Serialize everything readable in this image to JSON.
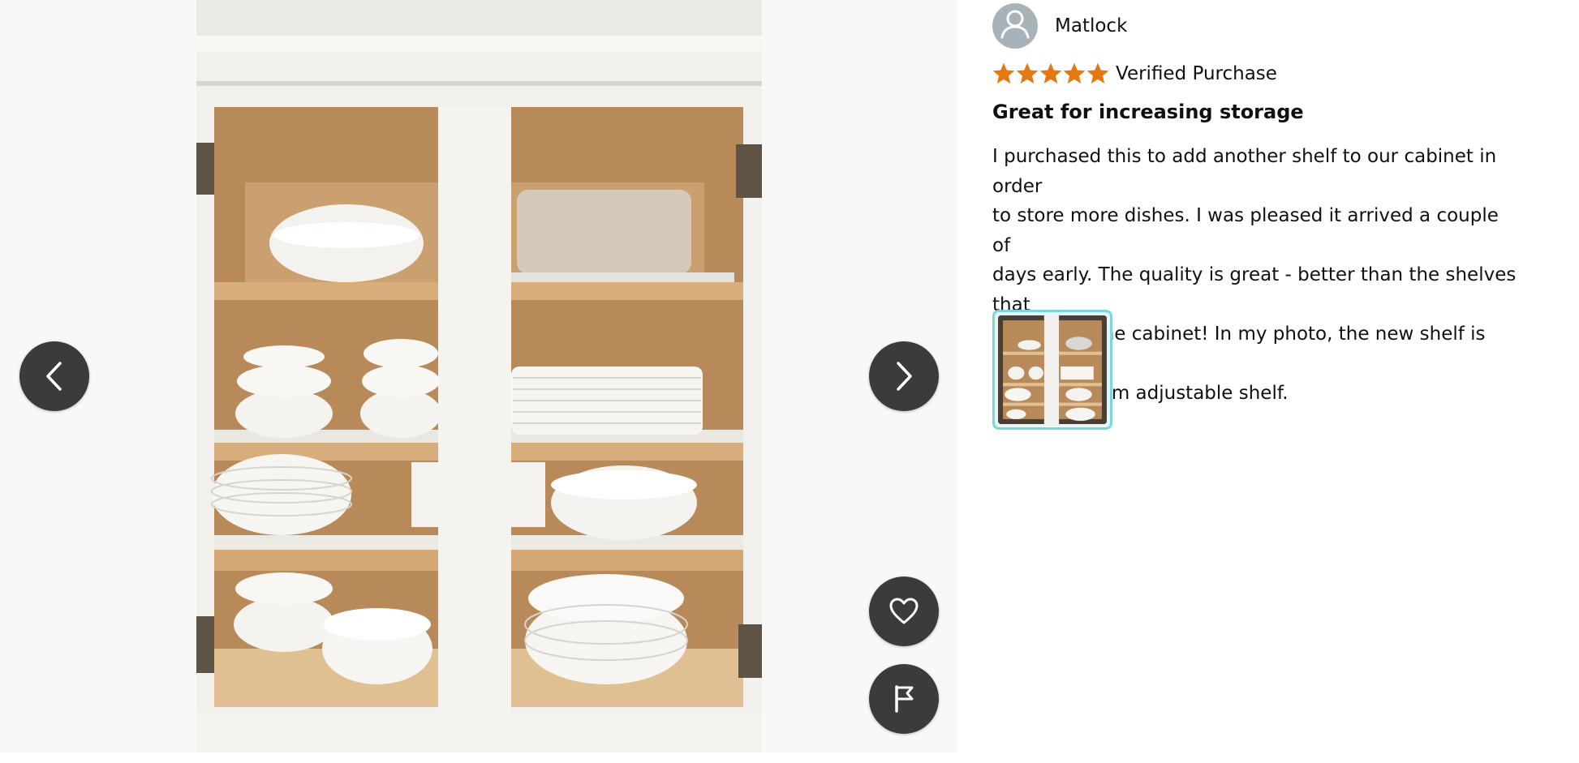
{
  "viewer": {
    "prev_icon": "chevron-left-icon",
    "next_icon": "chevron-right-icon",
    "like_icon": "heart-outline-icon",
    "flag_icon": "flag-icon",
    "photo": "review-photo-cabinet-with-dishes"
  },
  "review": {
    "author": "Matlock",
    "avatar_icon": "user-silhouette-icon",
    "rating": 5,
    "rating_max": 5,
    "star_color": "#e47911",
    "verified_label": "Verified Purchase",
    "title": "Great for increasing storage",
    "body_lines": [
      "I purchased this to add another shelf to our cabinet in order",
      "to store more dishes. I was pleased it arrived a couple of",
      "days early. The quality is great - better than the shelves that",
      "came with the cabinet! In my photo, the new shelf is the",
      "thicker bottom adjustable shelf."
    ],
    "thumbnail": "review-photo-thumbnail",
    "thumbnail_selected_color": "#7fd4e4"
  }
}
